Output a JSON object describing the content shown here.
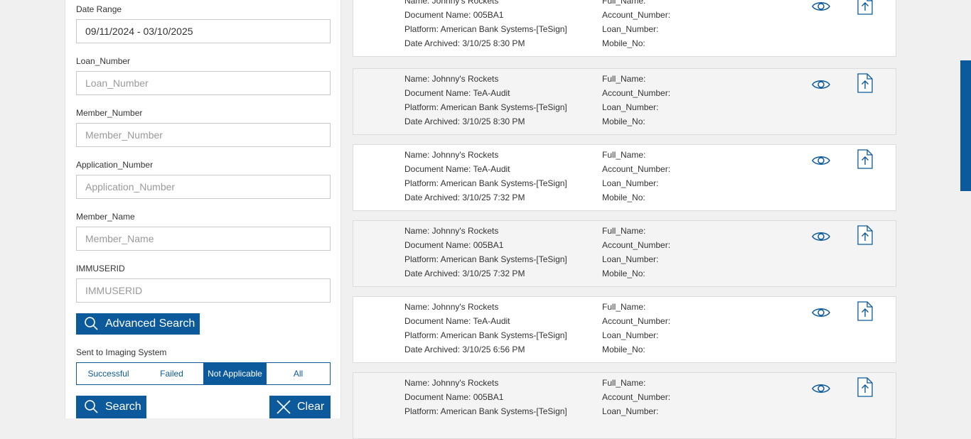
{
  "search": {
    "date_range": {
      "label": "Date Range",
      "value": "09/11/2024 - 03/10/2025"
    },
    "loan_number": {
      "label": "Loan_Number",
      "placeholder": "Loan_Number"
    },
    "member_number": {
      "label": "Member_Number",
      "placeholder": "Member_Number"
    },
    "application_number": {
      "label": "Application_Number",
      "placeholder": "Application_Number"
    },
    "member_name": {
      "label": "Member_Name",
      "placeholder": "Member_Name"
    },
    "immuserid": {
      "label": "IMMUSERID",
      "placeholder": "IMMUSERID"
    },
    "advanced_search_label": "Advanced Search",
    "sent_label": "Sent to Imaging System",
    "status_options": [
      "Successful",
      "Failed",
      "Not Applicable",
      "All"
    ],
    "status_selected": "Not Applicable",
    "search_label": "Search",
    "clear_label": "Clear"
  },
  "results": [
    {
      "left": [
        "Name: Johnny's Rockets",
        "Document Name: 005BA1",
        "Platform: American Bank Systems-[TeSign]",
        "Date Archived: 3/10/25 8:30 PM"
      ],
      "right": [
        "Full_Name:",
        "Account_Number:",
        "Loan_Number:",
        "Mobile_No:"
      ]
    },
    {
      "left": [
        "Name: Johnny's Rockets",
        "Document Name: TeA-Audit",
        "Platform: American Bank Systems-[TeSign]",
        "Date Archived: 3/10/25 8:30 PM"
      ],
      "right": [
        "Full_Name:",
        "Account_Number:",
        "Loan_Number:",
        "Mobile_No:"
      ]
    },
    {
      "left": [
        "Name: Johnny's Rockets",
        "Document Name: TeA-Audit",
        "Platform: American Bank Systems-[TeSign]",
        "Date Archived: 3/10/25 7:32 PM"
      ],
      "right": [
        "Full_Name:",
        "Account_Number:",
        "Loan_Number:",
        "Mobile_No:"
      ]
    },
    {
      "left": [
        "Name: Johnny's Rockets",
        "Document Name: 005BA1",
        "Platform: American Bank Systems-[TeSign]",
        "Date Archived: 3/10/25 7:32 PM"
      ],
      "right": [
        "Full_Name:",
        "Account_Number:",
        "Loan_Number:",
        "Mobile_No:"
      ]
    },
    {
      "left": [
        "Name: Johnny's Rockets",
        "Document Name: TeA-Audit",
        "Platform: American Bank Systems-[TeSign]",
        "Date Archived: 3/10/25 6:56 PM"
      ],
      "right": [
        "Full_Name:",
        "Account_Number:",
        "Loan_Number:",
        "Mobile_No:"
      ]
    },
    {
      "left": [
        "Name: Johnny's Rockets",
        "Document Name: 005BA1",
        "Platform: American Bank Systems-[TeSign]"
      ],
      "right": [
        "Full_Name:",
        "Account_Number:",
        "Loan_Number:"
      ]
    }
  ],
  "icons": {
    "view": "eye-icon",
    "upload": "upload-document-icon",
    "search": "search-icon",
    "clear": "close-icon"
  },
  "colors": {
    "accent": "#0c5a9c",
    "page_background": "#f0f0f0",
    "row_alt": "#f4f4f4"
  }
}
